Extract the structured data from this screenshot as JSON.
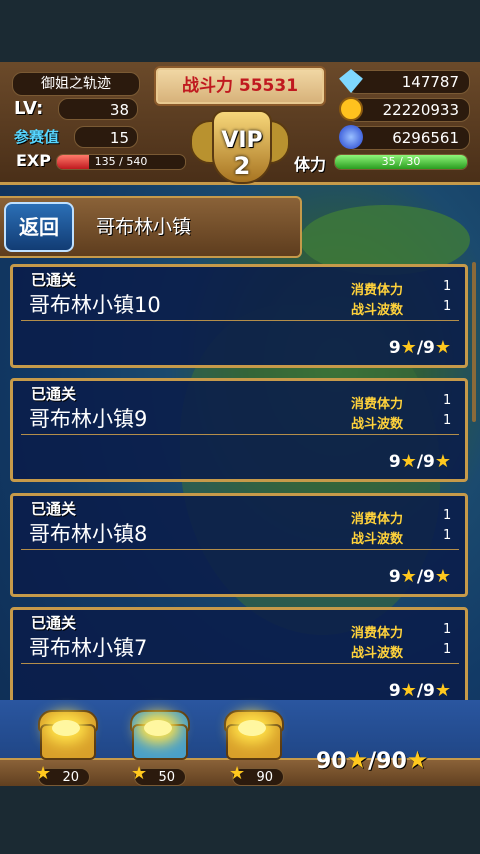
{
  "player": {
    "name": "御姐之轨迹",
    "lv_label": "LV:",
    "lv": "38",
    "rank_label": "参赛值",
    "rank": "15",
    "power_label": "战斗力",
    "power": "55531",
    "vip_label": "VIP",
    "vip_level": "2",
    "exp_label": "EXP",
    "exp_text": "135 / 540",
    "exp_fraction": 0.25,
    "stamina_label": "体力",
    "stamina_text": "35 / 30",
    "stamina_fraction": 1.0
  },
  "resources": [
    {
      "icon": "diamond-icon",
      "value": "147787",
      "color": "#7fd8ff"
    },
    {
      "icon": "gold-coin-icon",
      "value": "22220933",
      "color": "#ffc21e"
    },
    {
      "icon": "blue-orb-icon",
      "value": "6296561",
      "color": "#2f6bff"
    }
  ],
  "header": {
    "back_label": "返回",
    "title": "哥布林小镇"
  },
  "stages": [
    {
      "status": "已通关",
      "name": "哥布林小镇10",
      "cost_label": "消费体力",
      "cost": "1",
      "wave_label": "战斗波数",
      "waves": "1",
      "stars": "9",
      "max_stars": "/9"
    },
    {
      "status": "已通关",
      "name": "哥布林小镇9",
      "cost_label": "消费体力",
      "cost": "1",
      "wave_label": "战斗波数",
      "waves": "1",
      "stars": "9",
      "max_stars": "/9"
    },
    {
      "status": "已通关",
      "name": "哥布林小镇8",
      "cost_label": "消费体力",
      "cost": "1",
      "wave_label": "战斗波数",
      "waves": "1",
      "stars": "9",
      "max_stars": "/9"
    },
    {
      "status": "已通关",
      "name": "哥布林小镇7",
      "cost_label": "消费体力",
      "cost": "1",
      "wave_label": "战斗波数",
      "waves": "1",
      "stars": "9",
      "max_stars": "/9"
    }
  ],
  "chests": [
    {
      "required": "20",
      "color": "#d9a02a"
    },
    {
      "required": "50",
      "color": "#4aa0c8"
    },
    {
      "required": "90",
      "color": "#d9a02a"
    }
  ],
  "total_stars": {
    "current": "90",
    "max": "/90"
  },
  "colors": {
    "accent_gold": "#c69a4a",
    "panel_blue": "#0a1c4a",
    "label_yellow": "#ffd23b"
  }
}
